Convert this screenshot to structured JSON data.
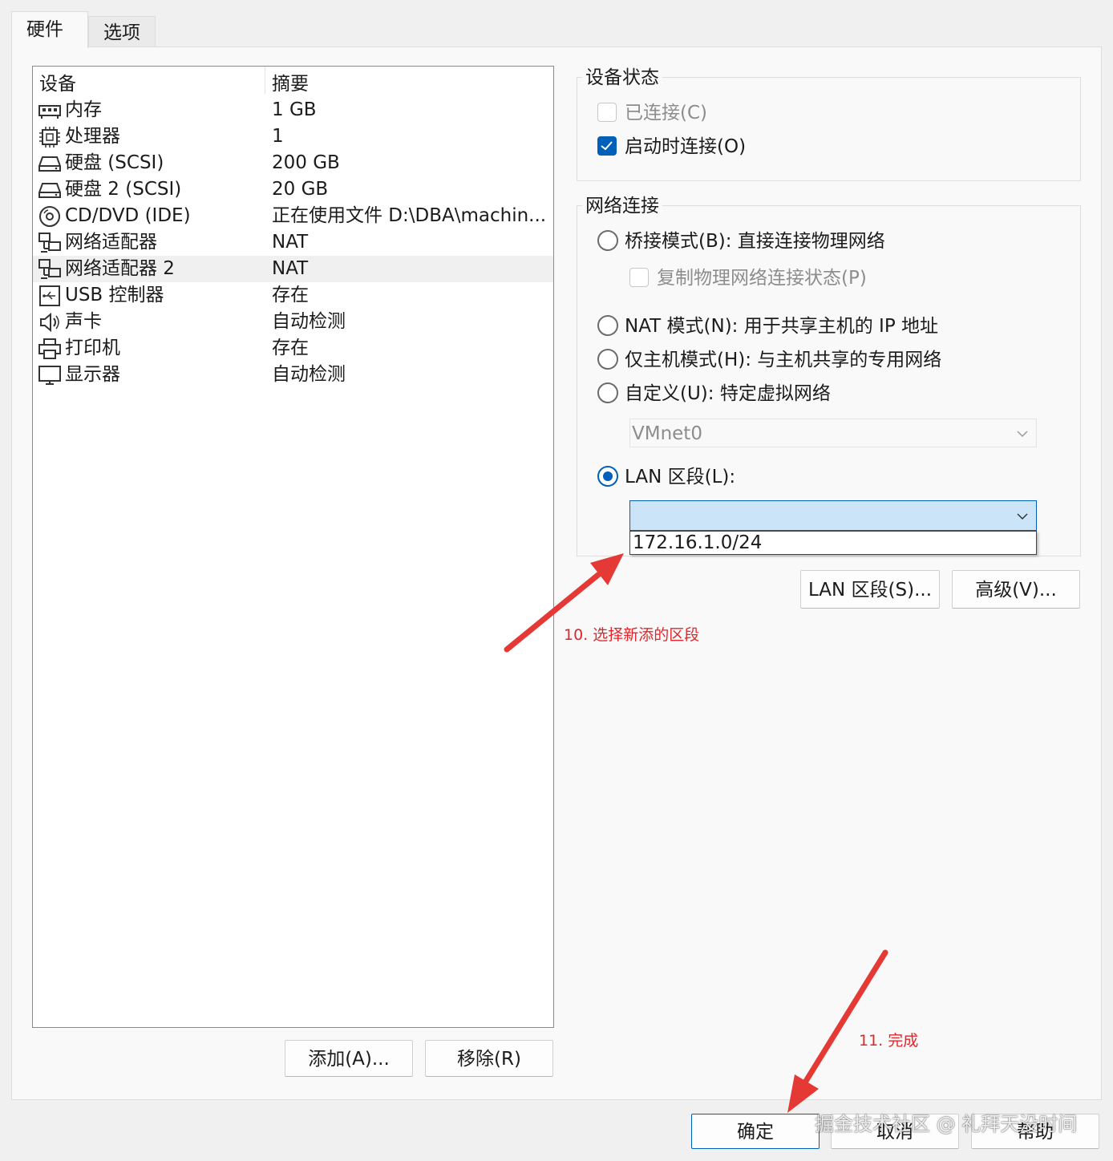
{
  "tabs": [
    {
      "label": "硬件",
      "active": true
    },
    {
      "label": "选项",
      "active": false
    }
  ],
  "device_list": {
    "headers": {
      "device": "设备",
      "summary": "摘要"
    },
    "rows": [
      {
        "icon": "memory-icon",
        "name": "内存",
        "summary": "1 GB"
      },
      {
        "icon": "processor-icon",
        "name": "处理器",
        "summary": "1"
      },
      {
        "icon": "hard-disk-icon",
        "name": "硬盘 (SCSI)",
        "summary": "200 GB"
      },
      {
        "icon": "hard-disk-icon",
        "name": "硬盘 2 (SCSI)",
        "summary": "20 GB"
      },
      {
        "icon": "cd-dvd-icon",
        "name": "CD/DVD (IDE)",
        "summary": "正在使用文件 D:\\DBA\\machin..."
      },
      {
        "icon": "network-adapter-icon",
        "name": "网络适配器",
        "summary": "NAT"
      },
      {
        "icon": "network-adapter-icon",
        "name": "网络适配器 2",
        "summary": "NAT",
        "selected": true
      },
      {
        "icon": "usb-icon",
        "name": "USB 控制器",
        "summary": "存在"
      },
      {
        "icon": "speaker-icon",
        "name": "声卡",
        "summary": "自动检测"
      },
      {
        "icon": "printer-icon",
        "name": "打印机",
        "summary": "存在"
      },
      {
        "icon": "monitor-icon",
        "name": "显示器",
        "summary": "自动检测"
      }
    ]
  },
  "list_buttons": {
    "add": "添加(A)...",
    "remove": "移除(R)"
  },
  "device_status": {
    "title": "设备状态",
    "connected": {
      "label": "已连接(C)",
      "checked": false,
      "disabled": true
    },
    "connect_at_power_on": {
      "label": "启动时连接(O)",
      "checked": true
    }
  },
  "network_connection": {
    "title": "网络连接",
    "bridged": {
      "label": "桥接模式(B): 直接连接物理网络",
      "selected": false
    },
    "replicate": {
      "label": "复制物理网络连接状态(P)",
      "checked": false,
      "disabled": true
    },
    "nat": {
      "label": "NAT 模式(N): 用于共享主机的 IP 地址",
      "selected": false
    },
    "host_only": {
      "label": "仅主机模式(H): 与主机共享的专用网络",
      "selected": false
    },
    "custom": {
      "label": "自定义(U): 特定虚拟网络",
      "selected": false
    },
    "custom_select_value": "VMnet0",
    "lan_segment": {
      "label": "LAN 区段(L):",
      "selected": true
    },
    "lan_select_value": "",
    "lan_dropdown_options": [
      "172.16.1.0/24"
    ]
  },
  "panel_buttons": {
    "lan_segments": "LAN 区段(S)...",
    "advanced": "高级(V)..."
  },
  "annotations": {
    "step10": "10. 选择新添的区段",
    "step11": "11. 完成"
  },
  "dialog_buttons": {
    "ok": "确定",
    "cancel": "取消",
    "help": "帮助"
  },
  "watermark": "掘金技术社区 @ 礼拜天没时间",
  "colors": {
    "accent": "#005fb8",
    "annotation": "#e0262b",
    "dropdown_highlight": "#cce4f7"
  }
}
